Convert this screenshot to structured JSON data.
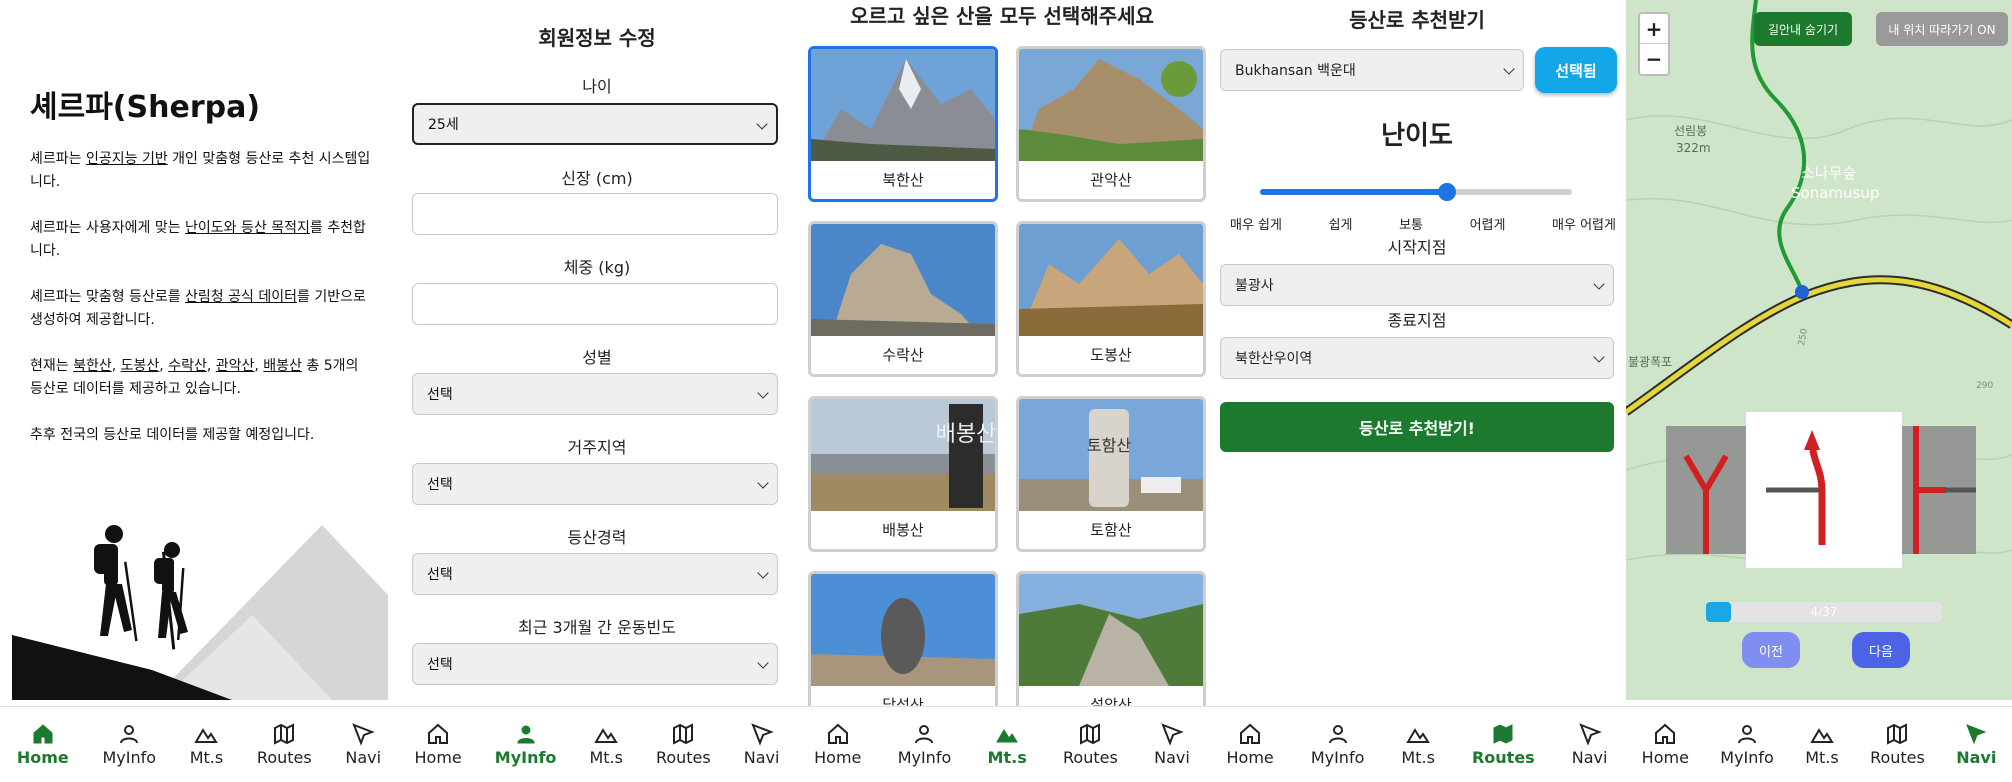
{
  "nav": {
    "home": "Home",
    "myinfo": "MyInfo",
    "mts": "Mt.s",
    "routes": "Routes",
    "navi": "Navi"
  },
  "intro": {
    "title": "셰르파(Sherpa)",
    "p1a": "셰르파는 ",
    "p1u": "인공지능 기반",
    "p1b": " 개인 맞춤형 등산로 추천 시스템입니다.",
    "p2a": "셰르파는 사용자에게 맞는 ",
    "p2u": "난이도와 등산 목적지",
    "p2b": "를 추천합니다.",
    "p3a": "셰르파는 맞춤형 등산로를 ",
    "p3u": "산림청 공식 데이터",
    "p3b": "를 기반으로 생성하여 제공합니다.",
    "p4a": "현재는 ",
    "p4m1": "북한산",
    "p4m2": "도봉산",
    "p4m3": "수락산",
    "p4m4": "관악산",
    "p4m5": "배봉산",
    "p4b": " 총 5개의 등산로 데이터를 제공하고 있습니다.",
    "p5": "추후 전국의 등산로 데이터를 제공할 예정입니다."
  },
  "profile": {
    "title": "회원정보 수정",
    "age_label": "나이",
    "age_value": "25세",
    "height_label": "신장 (cm)",
    "weight_label": "체중 (kg)",
    "gender_label": "성별",
    "gender_value": "선택",
    "region_label": "거주지역",
    "region_value": "선택",
    "exp_label": "등산경력",
    "exp_value": "선택",
    "freq_label": "최근 3개월 간 운동빈도",
    "freq_value": "선택"
  },
  "mountains": {
    "title": "오르고 싶은 산을 모두 선택해주세요",
    "items": [
      "북한산",
      "관악산",
      "수락산",
      "도봉산",
      "배봉산",
      "토함산",
      "담석산",
      "설악산"
    ],
    "selected_index": 0,
    "sign_baebong": "배봉산",
    "sign_toham": "토함산"
  },
  "routes": {
    "title": "등산로 추천받기",
    "mountain_value": "Bukhansan 백운대",
    "selected_label": "선택됨",
    "difficulty_title": "난이도",
    "difficulty_levels": [
      "매우 쉽게",
      "쉽게",
      "보통",
      "어렵게",
      "매우 어렵게"
    ],
    "difficulty_fraction": 0.6,
    "start_label": "시작지점",
    "start_value": "불광사",
    "end_label": "종료지점",
    "end_value": "북한산우이역",
    "submit_label": "등산로 추천받기!"
  },
  "navi": {
    "zoom_in": "+",
    "zoom_out": "−",
    "hide_guide": "길안내 숨기기",
    "follow_location": "내 위치 따라가기 ON",
    "progress_text": "4/37",
    "progress_fraction": 0.108,
    "prev": "이전",
    "next": "다음",
    "map_peak": "선림봉",
    "map_peak_elev": "322m",
    "map_place_ko": "소나무숲",
    "map_place_en": "Sonamusup",
    "map_falls": "불광폭포",
    "map_contour_a": "250",
    "map_contour_b": "290"
  },
  "colors": {
    "brand_green": "#1b7a2e",
    "selected_blue": "#1e73e6",
    "button_cyan": "#13a6e8",
    "map_bg": "#cfe5c9",
    "step_prev": "#7f8ef0",
    "step_next": "#4c63e6"
  }
}
